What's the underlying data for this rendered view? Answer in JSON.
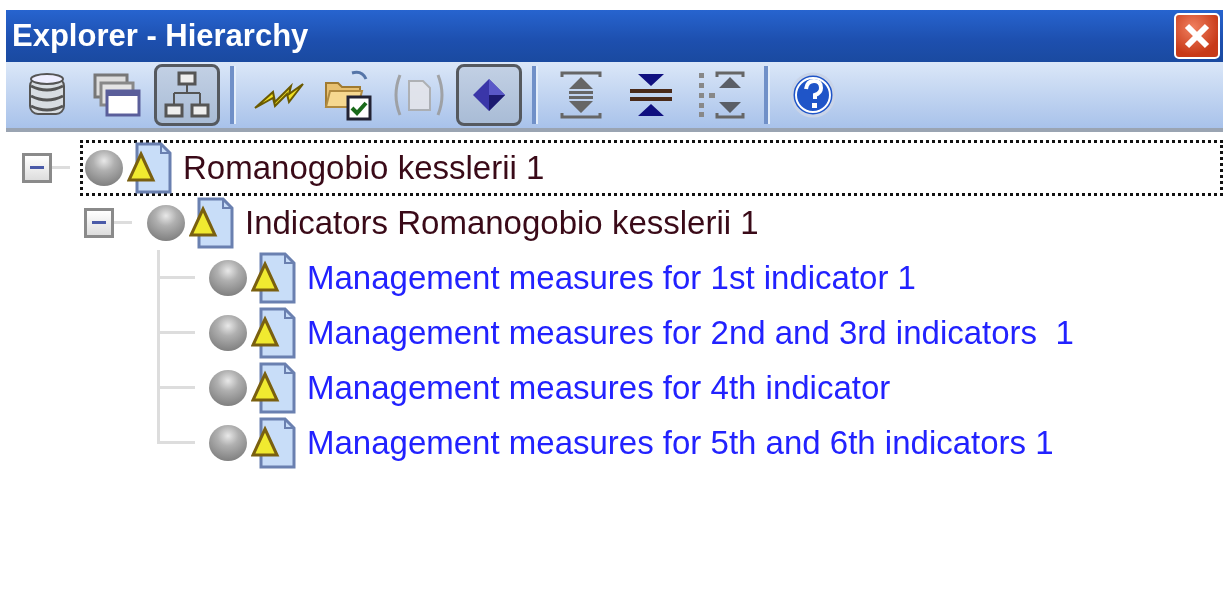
{
  "window": {
    "title": "Explorer - Hierarchy"
  },
  "toolbar": [
    [
      {
        "kind": "database",
        "pressed": false,
        "disabled": false
      },
      {
        "kind": "windows",
        "pressed": false,
        "disabled": false
      },
      {
        "kind": "hierarchy",
        "pressed": true,
        "disabled": false
      }
    ],
    [
      {
        "kind": "lightning",
        "pressed": false,
        "disabled": false
      },
      {
        "kind": "folder-check",
        "pressed": false,
        "disabled": false
      },
      {
        "kind": "document",
        "pressed": false,
        "disabled": true
      },
      {
        "kind": "diamond",
        "pressed": true,
        "disabled": false
      }
    ],
    [
      {
        "kind": "expand",
        "pressed": false,
        "disabled": false
      },
      {
        "kind": "collapse",
        "pressed": false,
        "disabled": false
      },
      {
        "kind": "expand-level",
        "pressed": false,
        "disabled": false
      }
    ],
    [
      {
        "kind": "help",
        "pressed": false,
        "disabled": false
      }
    ]
  ],
  "tree": [
    {
      "label": "Romanogobio kesslerii 1",
      "kind": "group",
      "expanded": true,
      "selected": true,
      "children": [
        {
          "label": "Indicators Romanogobio kesslerii 1",
          "kind": "group",
          "expanded": true,
          "selected": false,
          "children": [
            {
              "label": "Management measures for 1st indicator 1",
              "kind": "item",
              "selected": false
            },
            {
              "label": "Management measures for 2nd and 3rd indicators  1",
              "kind": "item",
              "selected": false
            },
            {
              "label": "Management measures for 4th indicator",
              "kind": "item",
              "selected": false
            },
            {
              "label": "Management measures for 5th and 6th indicators 1",
              "kind": "item",
              "selected": false
            }
          ]
        }
      ]
    }
  ]
}
